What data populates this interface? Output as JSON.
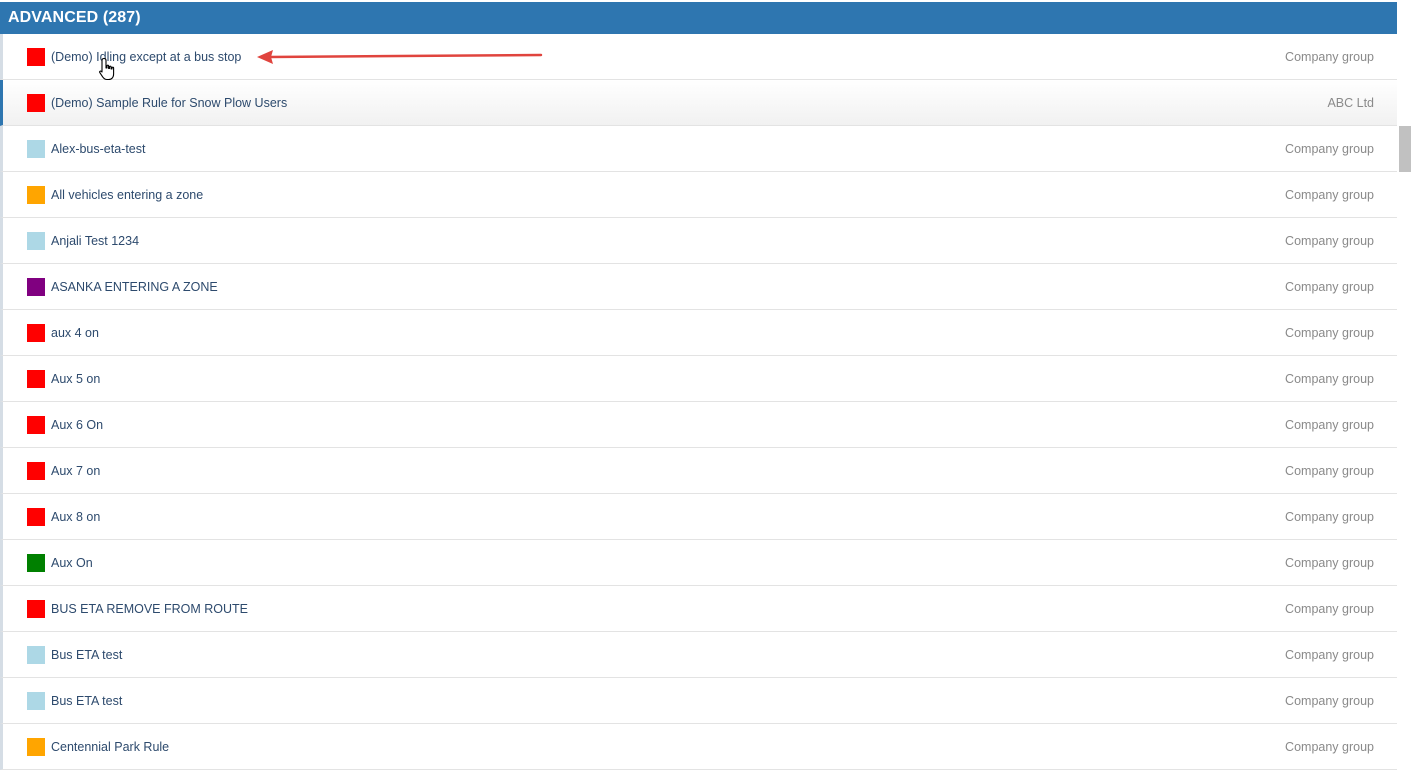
{
  "section": {
    "title": "ADVANCED (287)"
  },
  "colors": {
    "header": "#2e76b0",
    "red": "#ff0000",
    "lightblue": "#add8e6",
    "orange": "#ffa500",
    "purple": "#800080",
    "green": "#008000",
    "annotation_arrow": "#e0443e"
  },
  "rules": [
    {
      "name": "(Demo) Idling except at a bus stop",
      "owner": "Company group",
      "color": "#ff0000",
      "selected": false
    },
    {
      "name": "(Demo) Sample Rule for Snow Plow Users",
      "owner": "ABC Ltd",
      "color": "#ff0000",
      "selected": true
    },
    {
      "name": "Alex-bus-eta-test",
      "owner": "Company group",
      "color": "#add8e6",
      "selected": false
    },
    {
      "name": "All vehicles entering a zone",
      "owner": "Company group",
      "color": "#ffa500",
      "selected": false
    },
    {
      "name": "Anjali Test 1234",
      "owner": "Company group",
      "color": "#add8e6",
      "selected": false
    },
    {
      "name": "ASANKA ENTERING A ZONE",
      "owner": "Company group",
      "color": "#800080",
      "selected": false
    },
    {
      "name": "aux 4 on",
      "owner": "Company group",
      "color": "#ff0000",
      "selected": false
    },
    {
      "name": "Aux 5 on",
      "owner": "Company group",
      "color": "#ff0000",
      "selected": false
    },
    {
      "name": "Aux 6 On",
      "owner": "Company group",
      "color": "#ff0000",
      "selected": false
    },
    {
      "name": "Aux 7 on",
      "owner": "Company group",
      "color": "#ff0000",
      "selected": false
    },
    {
      "name": "Aux 8 on",
      "owner": "Company group",
      "color": "#ff0000",
      "selected": false
    },
    {
      "name": "Aux On",
      "owner": "Company group",
      "color": "#008000",
      "selected": false
    },
    {
      "name": "BUS ETA REMOVE FROM ROUTE",
      "owner": "Company group",
      "color": "#ff0000",
      "selected": false
    },
    {
      "name": "Bus ETA test",
      "owner": "Company group",
      "color": "#add8e6",
      "selected": false
    },
    {
      "name": "Bus ETA test",
      "owner": "Company group",
      "color": "#add8e6",
      "selected": false
    },
    {
      "name": "Centennial Park Rule",
      "owner": "Company group",
      "color": "#ffa500",
      "selected": false
    }
  ],
  "icons": {
    "cursor": "hand-pointer-icon",
    "annotation": "arrow-left-icon"
  }
}
